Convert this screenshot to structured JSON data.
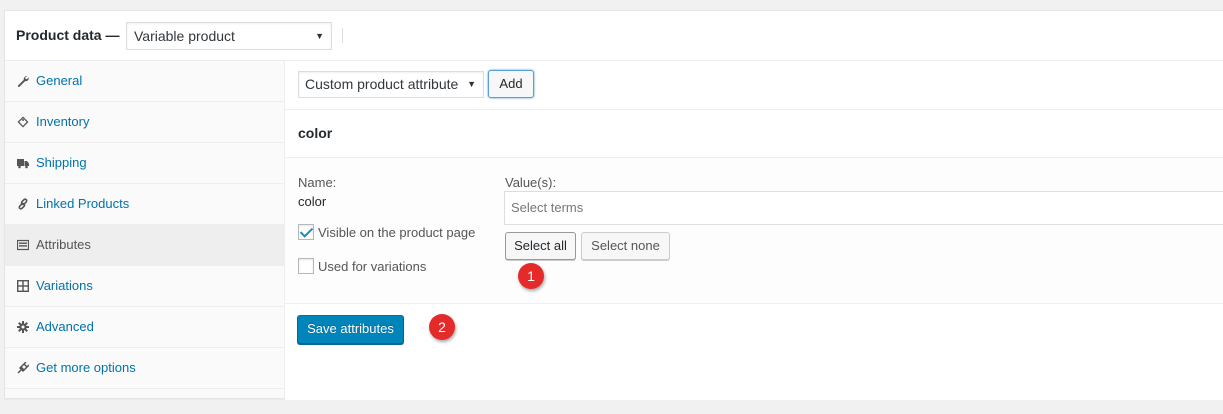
{
  "header": {
    "title": "Product data —",
    "product_type": "Variable product"
  },
  "tabs": [
    {
      "label": "General",
      "icon": "wrench-icon"
    },
    {
      "label": "Inventory",
      "icon": "tag-icon"
    },
    {
      "label": "Shipping",
      "icon": "truck-icon"
    },
    {
      "label": "Linked Products",
      "icon": "link-icon"
    },
    {
      "label": "Attributes",
      "icon": "list-icon",
      "active": true
    },
    {
      "label": "Variations",
      "icon": "grid-icon"
    },
    {
      "label": "Advanced",
      "icon": "gear-icon"
    },
    {
      "label": "Get more options",
      "icon": "plugin-icon"
    }
  ],
  "toolbar": {
    "attribute_type": "Custom product attribute",
    "add_label": "Add"
  },
  "attribute": {
    "title": "color",
    "name_label": "Name:",
    "name_value": "color",
    "values_label": "Value(s):",
    "terms_placeholder": "Select terms",
    "visible_label": "Visible on the product page",
    "visible_checked": true,
    "variations_label": "Used for variations",
    "variations_checked": false,
    "select_all_label": "Select all",
    "select_none_label": "Select none"
  },
  "save_label": "Save attributes",
  "markers": [
    "1",
    "2"
  ],
  "colors": {
    "link": "#0073aa",
    "primary": "#0085ba",
    "marker": "#e52a2a"
  }
}
